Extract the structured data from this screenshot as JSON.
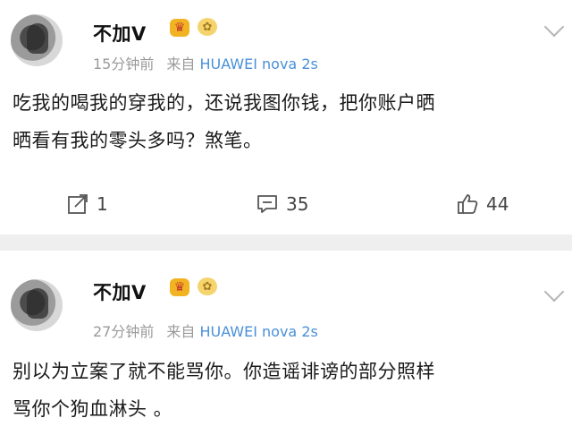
{
  "posts": [
    {
      "author": "不加V",
      "time": "15分钟前",
      "source_prefix": "来自",
      "device": "HUAWEI nova 2s",
      "text_lines": [
        "吃我的喝我的穿我的，还说我图你钱，把你账户晒",
        "晒看有我的零头多吗？煞笔。"
      ],
      "stats": {
        "repost": "1",
        "comment": "35",
        "like": "44"
      }
    },
    {
      "author": "不加V",
      "time": "27分钟前",
      "source_prefix": "来自",
      "device": "HUAWEI nova 2s",
      "text_lines": [
        "别以为立案了就不能骂你。你造谣诽谤的部分照样",
        "骂你个狗血淋头 。"
      ]
    }
  ],
  "icons": {
    "badge_crown": "crown-badge-icon",
    "badge_bean": "gold-bean-badge-icon",
    "menu": "chevron-down-icon",
    "repost": "repost-icon",
    "comment": "comment-icon",
    "like": "thumbs-up-icon"
  },
  "colors": {
    "device_link": "#4a90d9",
    "meta_text": "#9a9a9a",
    "divider": "#efefef"
  }
}
